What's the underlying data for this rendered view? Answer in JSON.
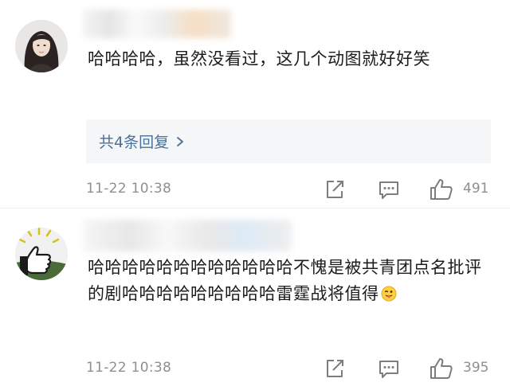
{
  "comments": [
    {
      "text": "哈哈哈哈，虽然没看过，这几个动图就好好笑",
      "replies_label": "共4条回复",
      "time": "11-22 10:38",
      "likes": "491"
    },
    {
      "text": "哈哈哈哈哈哈哈哈哈哈哈哈不愧是被共青团点名批评的剧哈哈哈哈哈哈哈哈哈雷霆战将值得",
      "time": "11-22 10:38",
      "likes": "395"
    }
  ],
  "icons": {
    "share": "share-icon",
    "comment": "comment-icon",
    "like": "thumbs-up-icon",
    "emoji": "tongue-out-emoji-icon",
    "chevron": "chevron-right-icon"
  },
  "colors": {
    "link": "#4a7196",
    "meta_text": "#8f8f8f",
    "reply_bg": "#f5f6f8"
  }
}
